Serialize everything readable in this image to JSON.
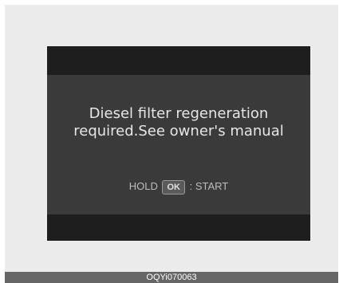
{
  "display": {
    "message_line1": "Diesel filter regeneration",
    "message_line2": "required.See owner's manual",
    "hold_label": "HOLD",
    "ok_key_label": "OK",
    "start_label": ": START"
  },
  "footer": {
    "code": "OQYi070063"
  },
  "colors": {
    "screen_bg": "#3a3a3a",
    "band_bg": "#1e1e1e",
    "frame_bg": "#ececec",
    "footer_bg": "#666666"
  }
}
